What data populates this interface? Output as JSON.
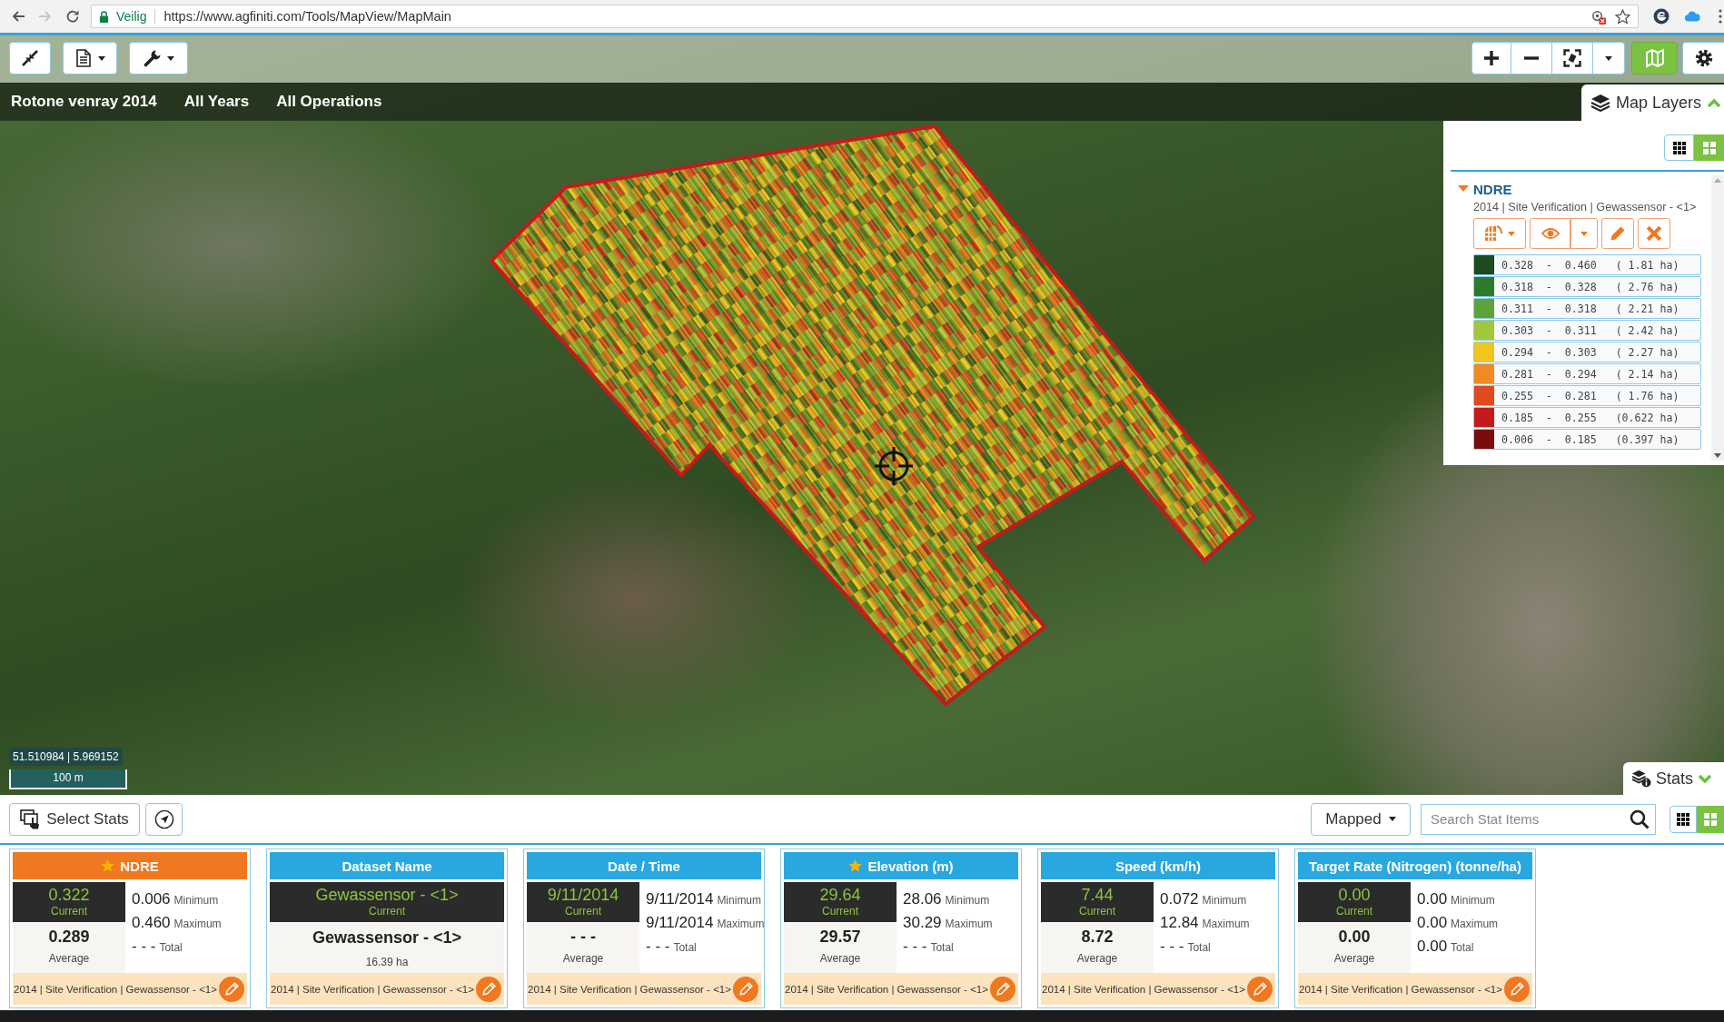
{
  "browser": {
    "forward_disabled": true,
    "status": "Veilig",
    "url": "https://www.agfiniti.com/Tools/MapView/MapMain"
  },
  "map": {
    "field": "Rotone venray 2014",
    "years": "All Years",
    "operations": "All Operations",
    "coordinates": "51.510984 | 5.969152",
    "scale": "100 m"
  },
  "map_layers": {
    "tab_label": "Map Layers",
    "view_modes": [
      {
        "kind": "list",
        "selected": false
      },
      {
        "kind": "tiles",
        "selected": true
      }
    ],
    "layer": {
      "name": "NDRE",
      "expanded": true,
      "source": "2014 | Site Verification | Gewassensor - <1>",
      "legend": [
        {
          "label": "0.328  -  0.460   ( 1.81 ha)",
          "color": "#1d4a1e"
        },
        {
          "label": "0.318  -  0.328   ( 2.76 ha)",
          "color": "#2d7a2d"
        },
        {
          "label": "0.311  -  0.318   ( 2.21 ha)",
          "color": "#5da33c"
        },
        {
          "label": "0.303  -  0.311   ( 2.42 ha)",
          "color": "#a3c73a"
        },
        {
          "label": "0.294  -  0.303   ( 2.27 ha)",
          "color": "#f2c51c"
        },
        {
          "label": "0.281  -  0.294   ( 2.14 ha)",
          "color": "#f08a24"
        },
        {
          "label": "0.255  -  0.281   ( 1.76 ha)",
          "color": "#e04a1c"
        },
        {
          "label": "0.185  -  0.255   (0.622 ha)",
          "color": "#c41a1c"
        },
        {
          "label": "0.006  -  0.185   (0.397 ha)",
          "color": "#7a0c0c"
        }
      ]
    }
  },
  "stats": {
    "tab_label": "Stats",
    "select_label": "Select Stats",
    "filter": "Mapped",
    "search_placeholder": "Search Stat Items",
    "view_modes": [
      {
        "kind": "list",
        "selected": false
      },
      {
        "kind": "tiles",
        "selected": true
      }
    ]
  },
  "stat_cards": [
    {
      "kind": "stat",
      "title": "NDRE",
      "starred": true,
      "selected": true,
      "current": "0.322",
      "current_label": "Current",
      "average": "0.289",
      "average_label": "Average",
      "minimum": "0.006",
      "minimum_label": "Minimum",
      "maximum": "0.460",
      "maximum_label": "Maximum",
      "total": "- - -",
      "total_label": "Total",
      "source": "2014 | Site Verification | Gewassensor - <1>"
    },
    {
      "kind": "dataset",
      "title": "Dataset Name",
      "starred": false,
      "selected": false,
      "current": "Gewassensor - <1>",
      "current_label": "Current",
      "value": "Gewassensor - <1>",
      "area": "16.39 ha",
      "source": "2014 | Site Verification | Gewassensor - <1>"
    },
    {
      "kind": "stat",
      "title": "Date / Time",
      "starred": false,
      "selected": false,
      "current": "9/11/2014",
      "current_label": "Current",
      "average": "- - -",
      "average_label": "Average",
      "minimum": "9/11/2014",
      "minimum_label": "Minimum",
      "maximum": "9/11/2014",
      "maximum_label": "Maximum",
      "total": "- - -",
      "total_label": "Total",
      "source": "2014 | Site Verification | Gewassensor - <1>"
    },
    {
      "kind": "stat",
      "title": "Elevation (m)",
      "starred": true,
      "selected": false,
      "current": "29.64",
      "current_label": "Current",
      "average": "29.57",
      "average_label": "Average",
      "minimum": "28.06",
      "minimum_label": "Minimum",
      "maximum": "30.29",
      "maximum_label": "Maximum",
      "total": "- - -",
      "total_label": "Total",
      "source": "2014 | Site Verification | Gewassensor - <1>"
    },
    {
      "kind": "stat",
      "title": "Speed (km/h)",
      "starred": false,
      "selected": false,
      "current": "7.44",
      "current_label": "Current",
      "average": "8.72",
      "average_label": "Average",
      "minimum": "0.072",
      "minimum_label": "Minimum",
      "maximum": "12.84",
      "maximum_label": "Maximum",
      "total": "- - -",
      "total_label": "Total",
      "source": "2014 | Site Verification | Gewassensor - <1>"
    },
    {
      "kind": "stat",
      "title": "Target Rate (Nitrogen) (tonne/ha)",
      "starred": false,
      "selected": false,
      "current": "0.00",
      "current_label": "Current",
      "average": "0.00",
      "average_label": "Average",
      "minimum": "0.00",
      "minimum_label": "Minimum",
      "maximum": "0.00",
      "maximum_label": "Maximum",
      "total": "0.00",
      "total_label": "Total",
      "source": "2014 | Site Verification | Gewassensor - <1>"
    }
  ]
}
